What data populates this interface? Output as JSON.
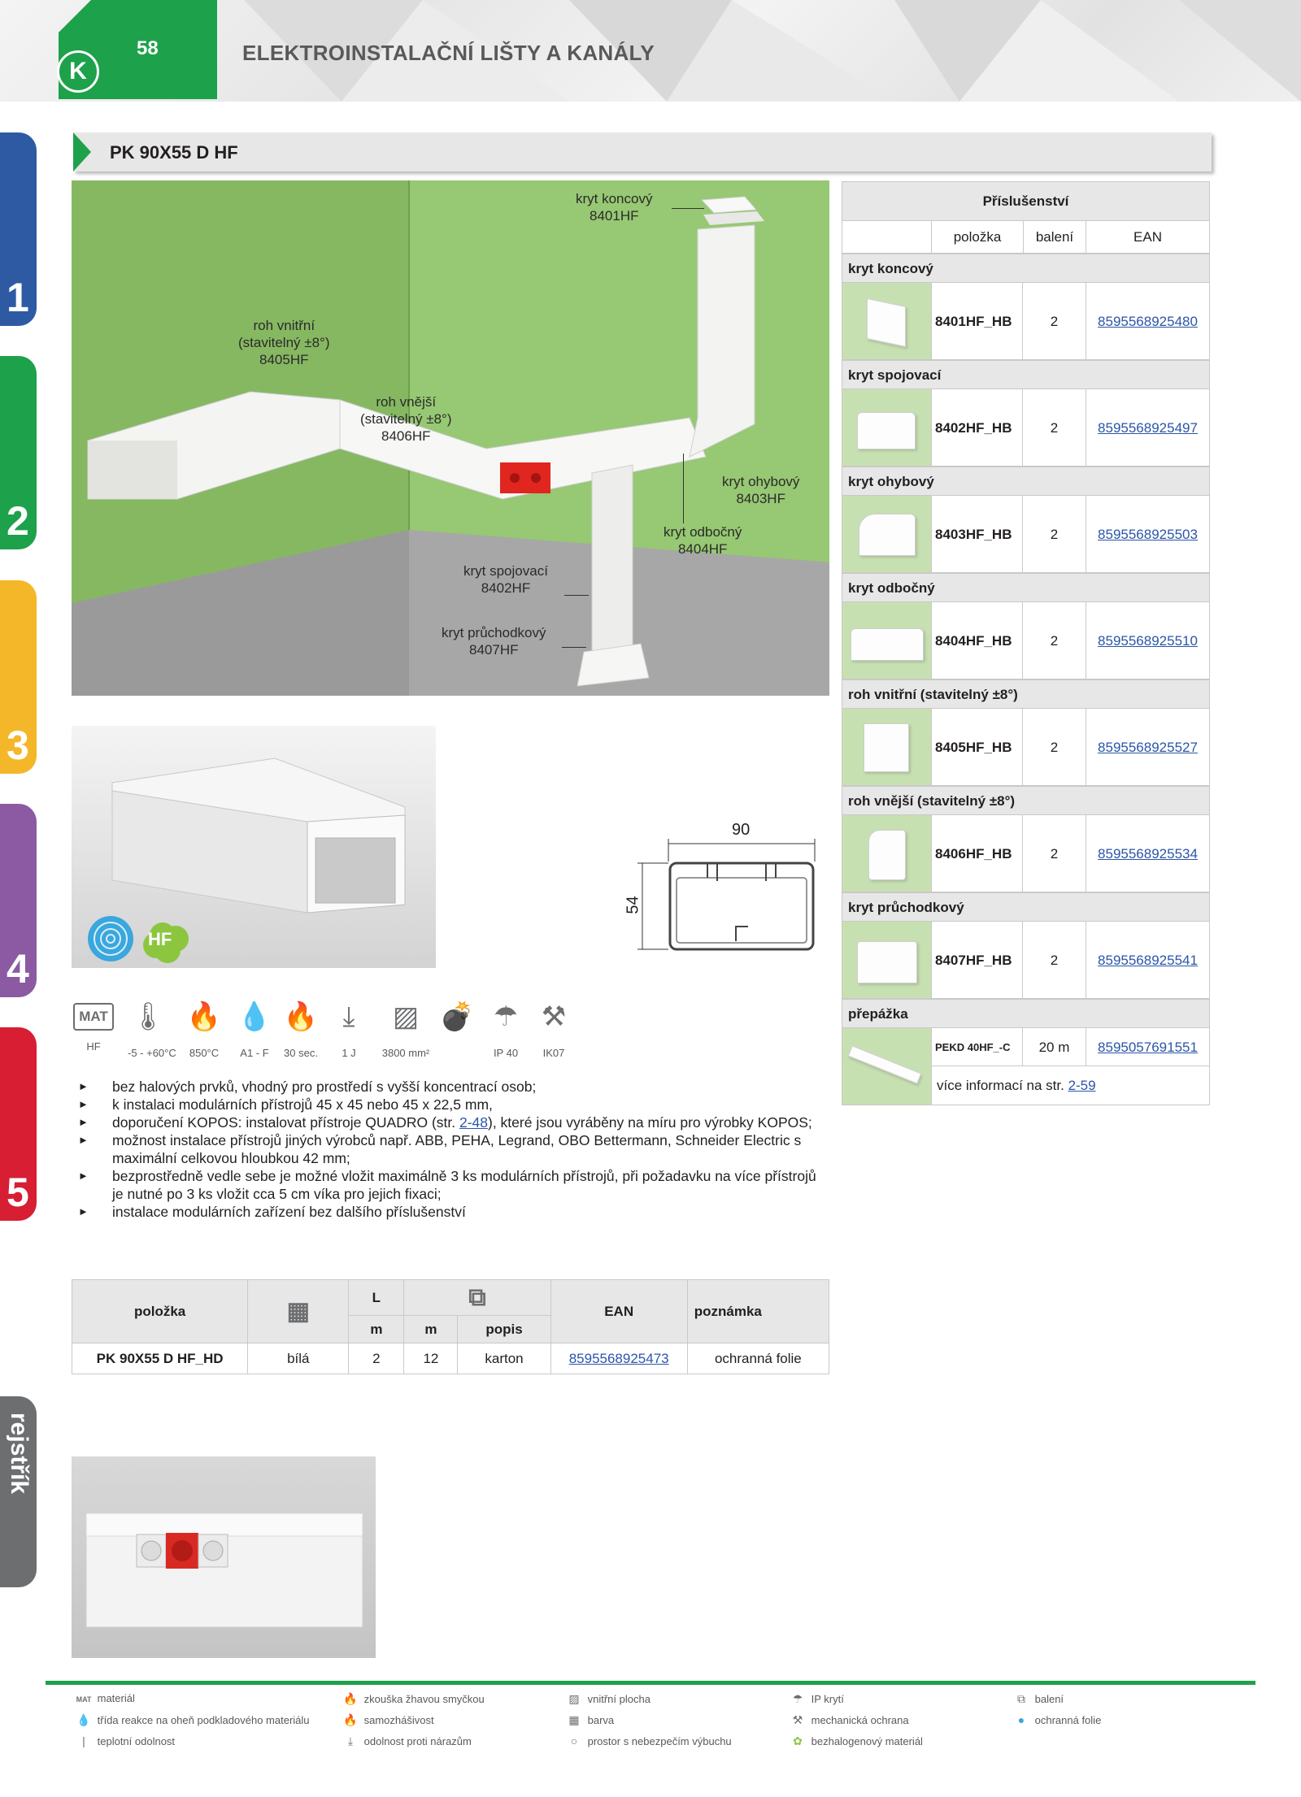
{
  "header": {
    "page_number": "58",
    "logo": "K",
    "section_title": "ELEKTROINSTALAČNÍ LIŠTY A KANÁLY"
  },
  "side_tabs": [
    {
      "label": "1",
      "color": "#2e5aa3"
    },
    {
      "label": "2",
      "color": "#1ea14b"
    },
    {
      "label": "3",
      "color": "#f5b72a"
    },
    {
      "label": "4",
      "color": "#8b5aa2"
    },
    {
      "label": "5",
      "color": "#d71e32"
    }
  ],
  "side_index": "rejstřík",
  "product_title": "PK 90X55 D HF",
  "scene_labels": {
    "end_cover": [
      "kryt koncový",
      "8401HF"
    ],
    "inner_corner": [
      "roh vnitřní",
      "(stavitelný ±8°)",
      "8405HF"
    ],
    "outer_corner": [
      "roh vnější",
      "(stavitelný ±8°)",
      "8406HF"
    ],
    "bend_cover": [
      "kryt ohybový",
      "8403HF"
    ],
    "branch_cover": [
      "kryt odbočný",
      "8404HF"
    ],
    "joint_cover": [
      "kryt spojovací",
      "8402HF"
    ],
    "pass_cover": [
      "kryt průchodkový",
      "8407HF"
    ]
  },
  "product_badges": {
    "hf": "HF"
  },
  "dimensions": {
    "width": "90",
    "height": "54"
  },
  "spec_icons": [
    {
      "icon": "material-icon",
      "symbol": "MAT",
      "caption": "HF"
    },
    {
      "icon": "thermometer-icon",
      "symbol": "🌡",
      "caption": "-5 - +60°C"
    },
    {
      "icon": "glow-wire-icon",
      "symbol": "🔥",
      "caption": "850°C"
    },
    {
      "icon": "flame-reaction-icon",
      "symbol": "💧",
      "caption": "A1 - F"
    },
    {
      "icon": "self-extinguishing-icon",
      "symbol": "🔥",
      "caption": "30 sec."
    },
    {
      "icon": "impact-icon",
      "symbol": "⤓",
      "caption": "1 J"
    },
    {
      "icon": "inner-area-icon",
      "symbol": "▨",
      "caption": "3800 mm²"
    },
    {
      "icon": "explosion-icon",
      "symbol": "💣",
      "caption": ""
    },
    {
      "icon": "ip-icon",
      "symbol": "☂",
      "caption": "IP 40"
    },
    {
      "icon": "ik-icon",
      "symbol": "⚒",
      "caption": "IK07"
    }
  ],
  "bullets": [
    {
      "text": "bez halových prvků, vhodný pro prostředí s vyšší koncentrací osob;"
    },
    {
      "text": "k instalaci modulárních přístrojů 45 x 45 nebo 45 x 22,5 mm,"
    },
    {
      "pre": "doporučení KOPOS: instalovat přístroje QUADRO (str. ",
      "link": "2-48",
      "post": "), které jsou vyráběny na míru pro výrobky KOPOS;"
    },
    {
      "text": "možnost instalace přístrojů jiných výrobců např. ABB, PEHA, Legrand, OBO Bettermann, Schneider Electric s maximální celkovou hloubkou 42 mm;"
    },
    {
      "text": "bezprostředně vedle sebe je možné vložit maximálně 3 ks modulárních přístrojů, při požadavku na více přístrojů je nutné po 3 ks vložit cca 5 cm víka pro jejich fixaci;"
    },
    {
      "text": "instalace modulárních zařízení bez dalšího příslušenství"
    }
  ],
  "accessories": {
    "title": "Příslušenství",
    "columns": [
      "položka",
      "balení",
      "EAN"
    ],
    "sections": [
      {
        "name": "kryt koncový",
        "code": "8401HF_HB",
        "qty": "2",
        "ean": "8595568925480"
      },
      {
        "name": "kryt spojovací",
        "code": "8402HF_HB",
        "qty": "2",
        "ean": "8595568925497"
      },
      {
        "name": "kryt ohybový",
        "code": "8403HF_HB",
        "qty": "2",
        "ean": "8595568925503"
      },
      {
        "name": "kryt odbočný",
        "code": "8404HF_HB",
        "qty": "2",
        "ean": "8595568925510"
      },
      {
        "name": "roh vnitřní (stavitelný ±8°)",
        "code": "8405HF_HB",
        "qty": "2",
        "ean": "8595568925527"
      },
      {
        "name": "roh vnější (stavitelný ±8°)",
        "code": "8406HF_HB",
        "qty": "2",
        "ean": "8595568925534"
      },
      {
        "name": "kryt průchodkový",
        "code": "8407HF_HB",
        "qty": "2",
        "ean": "8595568925541"
      }
    ],
    "divider": {
      "name": "přepážka",
      "code": "PEKD 40HF_-C",
      "qty": "20 m",
      "ean": "8595057691551",
      "more_pre": "více informací na str. ",
      "more_link": "2-59"
    }
  },
  "product_table": {
    "headers": {
      "item": "položka",
      "L": "L",
      "ean": "EAN",
      "note": "poznámka",
      "m1": "m",
      "m2": "m",
      "desc": "popis"
    },
    "row": {
      "item": "PK 90X55 D HF_HD",
      "color": "bílá",
      "L": "2",
      "pack": "12",
      "desc": "karton",
      "ean": "8595568925473",
      "note": "ochranná folie"
    }
  },
  "legend": [
    {
      "icon": "material-icon",
      "symbol": "MAT",
      "text": "materiál"
    },
    {
      "icon": "flame-reaction-icon",
      "symbol": "💧",
      "text": "třída reakce na oheň podkladového materiálu"
    },
    {
      "icon": "thermometer-icon",
      "symbol": "|",
      "text": "teplotní odolnost"
    },
    {
      "icon": "glow-wire-icon",
      "symbol": "🔥",
      "text": "zkouška žhavou smyčkou"
    },
    {
      "icon": "self-extinguishing-icon",
      "symbol": "🔥",
      "text": "samozhášivost"
    },
    {
      "icon": "impact-icon",
      "symbol": "⤓",
      "text": "odolnost proti nárazům"
    },
    {
      "icon": "inner-area-icon",
      "symbol": "▨",
      "text": "vnitřní plocha"
    },
    {
      "icon": "color-icon",
      "symbol": "▦",
      "text": "barva"
    },
    {
      "icon": "explosion-icon",
      "symbol": "○",
      "text": "prostor s nebezpečím výbuchu"
    },
    {
      "icon": "ip-icon",
      "symbol": "☂",
      "text": "IP krytí"
    },
    {
      "icon": "ik-icon",
      "symbol": "⚒",
      "text": "mechanická ochrana"
    },
    {
      "icon": "hf-icon",
      "symbol": "✿",
      "text": "bezhalogenový materiál"
    },
    {
      "icon": "package-icon",
      "symbol": "⧉",
      "text": "balení"
    },
    {
      "icon": "protective-foil-icon",
      "symbol": "●",
      "text": "ochranná folie"
    }
  ]
}
